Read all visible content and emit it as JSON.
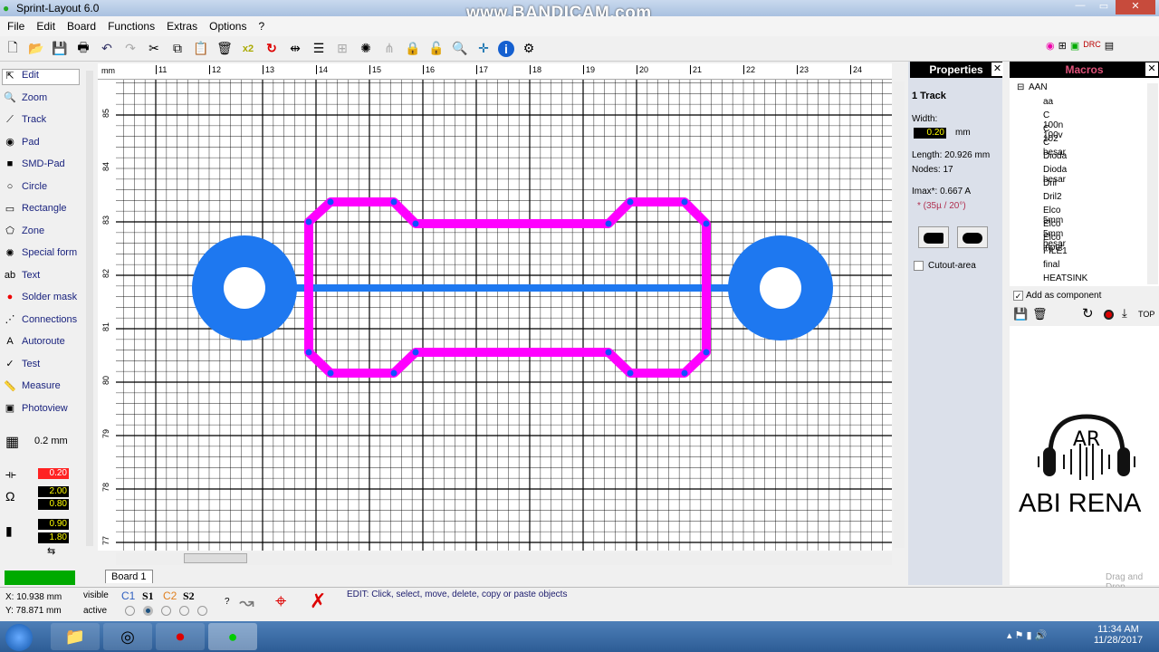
{
  "window": {
    "title": "Sprint-Layout 6.0",
    "watermark": "www.BANDICAM.com"
  },
  "menu": [
    "File",
    "Edit",
    "Board",
    "Functions",
    "Extras",
    "Options",
    "?"
  ],
  "toolbar_icons": [
    "new-file-icon",
    "open-folder-icon",
    "save-icon",
    "print-icon",
    "undo-icon",
    "redo-icon",
    "cut-icon",
    "copy-icon",
    "paste-icon",
    "delete-icon",
    "x2-icon",
    "rotate-icon",
    "mirror-icon",
    "align-icon",
    "group-icon",
    "explode-icon",
    "connect-icon",
    "lock-icon",
    "unlock-icon",
    "zoom-icon",
    "crosshair-icon",
    "info-icon",
    "drc-icon"
  ],
  "tools": [
    {
      "label": "Edit",
      "icon": "arrow-icon"
    },
    {
      "label": "Zoom",
      "icon": "magnifier-icon"
    },
    {
      "label": "Track",
      "icon": "track-icon"
    },
    {
      "label": "Pad",
      "icon": "pad-icon"
    },
    {
      "label": "SMD-Pad",
      "icon": "smd-icon"
    },
    {
      "label": "Circle",
      "icon": "circle-icon"
    },
    {
      "label": "Rectangle",
      "icon": "rectangle-icon"
    },
    {
      "label": "Zone",
      "icon": "zone-icon"
    },
    {
      "label": "Special form",
      "icon": "special-form-icon"
    },
    {
      "label": "Text",
      "icon": "text-icon"
    },
    {
      "label": "Solder mask",
      "icon": "solder-mask-icon"
    },
    {
      "label": "Connections",
      "icon": "connections-icon"
    },
    {
      "label": "Autoroute",
      "icon": "autoroute-icon"
    },
    {
      "label": "Test",
      "icon": "test-icon"
    },
    {
      "label": "Measure",
      "icon": "measure-icon"
    },
    {
      "label": "Photoview",
      "icon": "photoview-icon"
    }
  ],
  "grid": "0.2 mm",
  "values": {
    "track_width": "0.20",
    "pad_outer": "2.00",
    "pad_inner": "0.80",
    "smd_w": "0.90",
    "smd_h": "1.80"
  },
  "ruler": {
    "unit": "mm",
    "x_ticks": [
      "11",
      "12",
      "13",
      "14",
      "15",
      "16",
      "17",
      "18",
      "19",
      "20",
      "21",
      "22",
      "23",
      "24"
    ],
    "y_ticks": [
      "85",
      "84",
      "83",
      "82",
      "81",
      "80",
      "79",
      "78",
      "77"
    ]
  },
  "board_tab": "Board 1",
  "properties": {
    "title": "Properties",
    "type": "1 Track",
    "width_label": "Width:",
    "width_value": "0.20",
    "width_unit": "mm",
    "length": "Length:  20.926 mm",
    "nodes": "Nodes:  17",
    "imax": "Imax*:  0.667 A",
    "imax_note": "* (35µ / 20°)",
    "cutout": "Cutout-area"
  },
  "macros": {
    "title": "Macros",
    "root": "AAN",
    "items": [
      "aa",
      "C 100n 100v",
      "C 102",
      "C besar",
      "Dioda",
      "Dioda besar",
      "Dril",
      "Dril2",
      "Elco 5mm",
      "Elco 5mm besar",
      "Elco input",
      "FILE1",
      "final",
      "HEATSINK"
    ],
    "add_component": "Add as component",
    "top_label": "TOP",
    "logo_text": "ABI RENA",
    "logo_mono": "AR",
    "drag_drop": "Drag and Drop"
  },
  "status": {
    "x": "X:   10.938 mm",
    "y": "Y:   78.871 mm",
    "visible": "visible",
    "active": "active",
    "layers": [
      "C1",
      "S1",
      "C2",
      "S2"
    ],
    "help": "?",
    "message": "EDIT:  Click, select, move, delete, copy or paste objects"
  },
  "taskbar": {
    "time": "11:34 AM",
    "date": "11/28/2017"
  },
  "colors": {
    "track": "#ff00ff",
    "pad": "#1e78f0",
    "grid": "#000000"
  }
}
